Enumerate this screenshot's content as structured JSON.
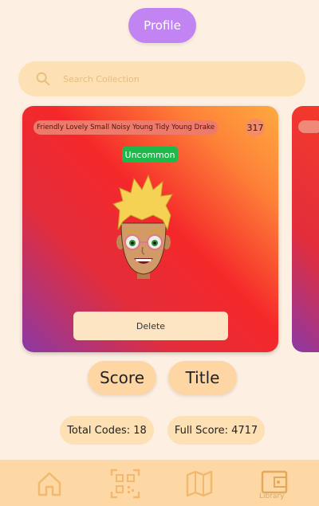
{
  "header": {
    "profile_label": "Profile"
  },
  "search": {
    "placeholder": "Search Collection"
  },
  "card": {
    "name": "Friendly Lovely Small Noisy Young Tidy Young Drake",
    "score": "317",
    "rarity": "Uncommon",
    "delete_label": "Delete"
  },
  "sort": {
    "score_label": "Score",
    "title_label": "Title"
  },
  "stats": {
    "total_codes": "Total Codes: 18",
    "full_score": "Full Score: 4717"
  },
  "nav": {
    "items": [
      {
        "icon": "home-icon"
      },
      {
        "icon": "qr-code-icon"
      },
      {
        "icon": "map-icon"
      },
      {
        "icon": "wallet-icon",
        "label": "Library"
      }
    ]
  },
  "colors": {
    "accent": "#c284f2",
    "background": "#fdf0e3",
    "pill": "#fde0b4",
    "navbar": "#fdd8a4",
    "rarity": "#1fb84a"
  }
}
